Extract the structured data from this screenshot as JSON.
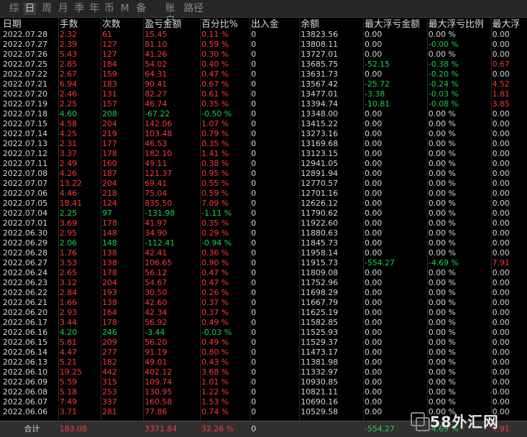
{
  "tabs": [
    "综",
    "日",
    "周",
    "月",
    "季",
    "年",
    "币",
    "M",
    "备",
    "账户",
    "路径"
  ],
  "active_tab": 1,
  "headers": [
    "日期",
    "手数",
    "次数",
    "盈亏金额",
    "百分比%",
    "出入金",
    "余额",
    "最大浮亏金额",
    "最大浮亏比例",
    "最大浮"
  ],
  "rows": [
    [
      "2022.07.28",
      "2.32",
      "61",
      "15.45",
      "0.11 %",
      "0",
      "13823.56",
      "0.00",
      "0.00 %",
      "0.00"
    ],
    [
      "2022.07.27",
      "2.39",
      "127",
      "81.10",
      "0.59 %",
      "0",
      "13808.11",
      "0.00",
      "-0.00 %",
      "0.00"
    ],
    [
      "2022.07.26",
      "5.43",
      "127",
      "41.26",
      "0.30 %",
      "0",
      "13727.01",
      "0.00",
      "0.00 %",
      "0.00"
    ],
    [
      "2022.07.25",
      "2.85",
      "184",
      "54.02",
      "0.40 %",
      "0",
      "13685.75",
      "-52.15",
      "-0.38 %",
      "0.67"
    ],
    [
      "2022.07.22",
      "2.67",
      "159",
      "64.31",
      "0.47 %",
      "0",
      "13631.73",
      "0.00",
      "-0.20 %",
      "0.00"
    ],
    [
      "2022.07.21",
      "6.94",
      "183",
      "90.41",
      "0.67 %",
      "0",
      "13567.42",
      "-25.72",
      "-0.24 %",
      "4.52"
    ],
    [
      "2022.07.20",
      "2.46",
      "131",
      "82.27",
      "0.61 %",
      "0",
      "13477.01",
      "-3.38",
      "-0.03 %",
      "1.81"
    ],
    [
      "2022.07.19",
      "2.25",
      "157",
      "46.74",
      "0.35 %",
      "0",
      "13394.74",
      "-10.81",
      "-0.08 %",
      "3.85"
    ],
    [
      "2022.07.18",
      "4.60",
      "208",
      "-67.22",
      "-0.50 %",
      "0",
      "13348.00",
      "0.00",
      "0.00 %",
      "0.00"
    ],
    [
      "2022.07.15",
      "4.58",
      "204",
      "142.06",
      "1.07 %",
      "0",
      "13415.22",
      "0.00",
      "0.00 %",
      "0.00"
    ],
    [
      "2022.07.14",
      "4.25",
      "219",
      "103.48",
      "0.79 %",
      "0",
      "13273.16",
      "0.00",
      "0.00 %",
      "0.00"
    ],
    [
      "2022.07.13",
      "2.31",
      "177",
      "46.53",
      "0.35 %",
      "0",
      "13169.68",
      "0.00",
      "0.00 %",
      "0.00"
    ],
    [
      "2022.07.12",
      "3.37",
      "178",
      "182.10",
      "1.41 %",
      "0",
      "13123.15",
      "0.00",
      "0.00 %",
      "0.00"
    ],
    [
      "2022.07.11",
      "2.49",
      "160",
      "49.11",
      "0.38 %",
      "0",
      "12941.05",
      "0.00",
      "0.00 %",
      "0.00"
    ],
    [
      "2022.07.08",
      "4.26",
      "187",
      "121.37",
      "0.95 %",
      "0",
      "12891.94",
      "0.00",
      "0.00 %",
      "0.00"
    ],
    [
      "2022.07.07",
      "13.22",
      "204",
      "69.41",
      "0.55 %",
      "0",
      "12770.57",
      "0.00",
      "0.00 %",
      "0.00"
    ],
    [
      "2022.07.06",
      "4.46",
      "218",
      "75.04",
      "0.59 %",
      "0",
      "12701.16",
      "0.00",
      "0.00 %",
      "0.00"
    ],
    [
      "2022.07.05",
      "18.41",
      "124",
      "835.50",
      "7.09 %",
      "0",
      "12626.12",
      "0.00",
      "0.00 %",
      "0.00"
    ],
    [
      "2022.07.04",
      "2.25",
      "97",
      "-131.98",
      "-1.11 %",
      "0",
      "11790.62",
      "0.00",
      "0.00 %",
      "0.00"
    ],
    [
      "2022.07.01",
      "3.69",
      "178",
      "41.97",
      "0.35 %",
      "0",
      "11922.60",
      "0.00",
      "0.00 %",
      "0.00"
    ],
    [
      "2022.06.30",
      "2.95",
      "148",
      "34.90",
      "0.29 %",
      "0",
      "11880.63",
      "0.00",
      "0.00 %",
      "0.00"
    ],
    [
      "2022.06.29",
      "2.06",
      "148",
      "-112.41",
      "-0.94 %",
      "0",
      "11845.73",
      "0.00",
      "0.00 %",
      "0.00"
    ],
    [
      "2022.06.28",
      "1.76",
      "138",
      "42.41",
      "0.36 %",
      "0",
      "11958.14",
      "0.00",
      "0.00 %",
      "0.00"
    ],
    [
      "2022.06.27",
      "3.53",
      "138",
      "106.65",
      "0.90 %",
      "0",
      "11915.73",
      "-554.27",
      "-4.69 %",
      "7.91"
    ],
    [
      "2022.06.24",
      "2.65",
      "178",
      "56.12",
      "0.47 %",
      "0",
      "11809.08",
      "0.00",
      "0.00 %",
      "0.00"
    ],
    [
      "2022.06.23",
      "3.12",
      "204",
      "54.67",
      "0.47 %",
      "0",
      "11752.96",
      "0.00",
      "0.00 %",
      "0.00"
    ],
    [
      "2022.06.22",
      "2.84",
      "193",
      "30.50",
      "0.26 %",
      "0",
      "11698.29",
      "0.00",
      "0.00 %",
      "0.00"
    ],
    [
      "2022.06.21",
      "1.66",
      "138",
      "42.60",
      "0.37 %",
      "0",
      "11667.79",
      "0.00",
      "0.00 %",
      "0.00"
    ],
    [
      "2022.06.20",
      "2.93",
      "164",
      "42.34",
      "0.37 %",
      "0",
      "11625.19",
      "0.00",
      "0.00 %",
      "0.00"
    ],
    [
      "2022.06.17",
      "3.44",
      "178",
      "56.92",
      "0.49 %",
      "0",
      "11582.85",
      "0.00",
      "0.00 %",
      "0.00"
    ],
    [
      "2022.06.16",
      "4.20",
      "246",
      "-3.44",
      "-0.03 %",
      "0",
      "11525.93",
      "0.00",
      "0.00 %",
      "0.00"
    ],
    [
      "2022.06.15",
      "5.81",
      "209",
      "56.20",
      "0.49 %",
      "0",
      "11529.37",
      "0.00",
      "0.00 %",
      "0.00"
    ],
    [
      "2022.06.14",
      "4.47",
      "277",
      "91.19",
      "0.80 %",
      "0",
      "11473.17",
      "0.00",
      "0.00 %",
      "0.00"
    ],
    [
      "2022.06.13",
      "5.21",
      "182",
      "49.01",
      "0.43 %",
      "0",
      "11381.98",
      "0.00",
      "0.00 %",
      "0.00"
    ],
    [
      "2022.06.10",
      "19.25",
      "442",
      "402.12",
      "3.68 %",
      "0",
      "11332.97",
      "0.00",
      "0.00 %",
      "0.00"
    ],
    [
      "2022.06.09",
      "5.59",
      "315",
      "109.74",
      "1.01 %",
      "0",
      "10930.85",
      "0.00",
      "0.00 %",
      "0.00"
    ],
    [
      "2022.06.08",
      "5.18",
      "253",
      "130.95",
      "1.22 %",
      "0",
      "10821.11",
      "0.00",
      "0.00 %",
      "0.00"
    ],
    [
      "2022.06.07",
      "7.49",
      "337",
      "160.58",
      "1.53 %",
      "0",
      "10690.16",
      "0.00",
      "0.00 %",
      "0.00"
    ],
    [
      "2022.06.06",
      "3.71",
      "281",
      "77.86",
      "0.74 %",
      "0",
      "10529.58",
      "0.00",
      "0.00 %",
      "0.00"
    ]
  ],
  "total": [
    "合计",
    "183.08",
    "",
    "3371.84",
    "32.26 %",
    "0",
    "",
    "-554.27",
    "-4.69 %",
    "7.91"
  ],
  "watermark": "58外汇网",
  "colors": {
    "positive": "#ff3838",
    "negative": "#17d24b",
    "neutral": "#d8d8d8",
    "background": "#000000"
  }
}
